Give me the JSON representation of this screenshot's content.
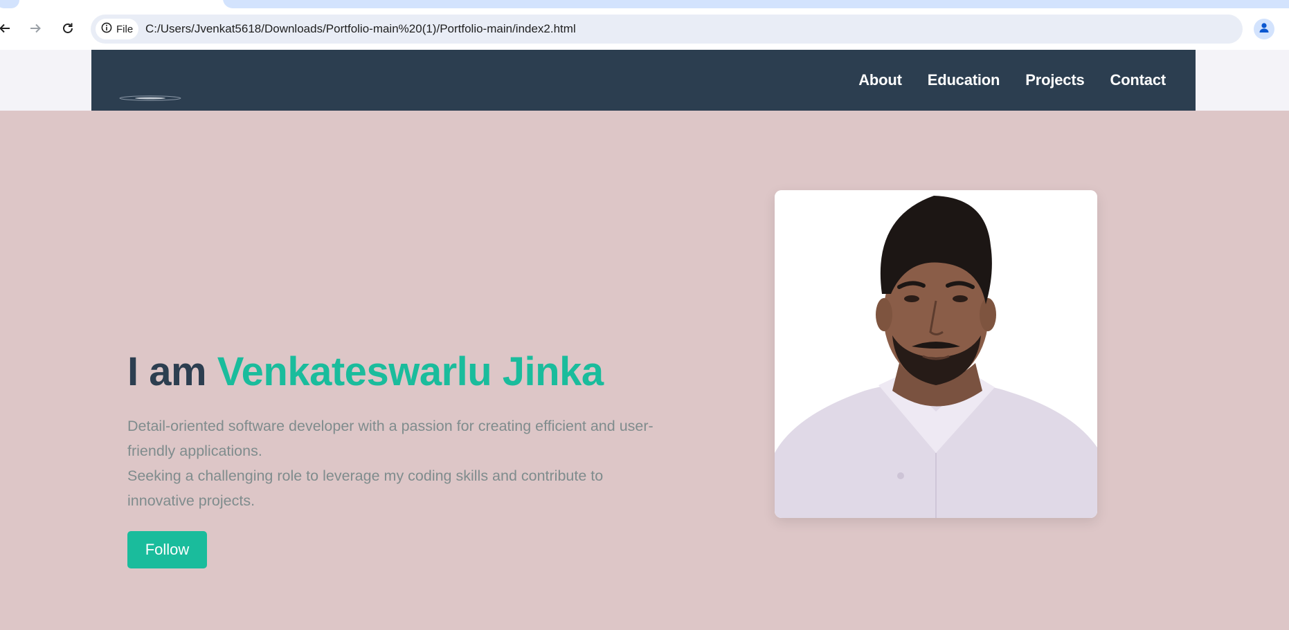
{
  "browser": {
    "file_chip_label": "File",
    "url": "C:/Users/Jvenkat5618/Downloads/Portfolio-main%20(1)/Portfolio-main/index2.html",
    "icons": {
      "back": "back-arrow-icon",
      "forward": "forward-arrow-icon",
      "reload": "reload-icon",
      "info": "info-icon",
      "bookmark": "star-icon",
      "profile": "profile-icon"
    }
  },
  "site": {
    "nav": {
      "items": [
        "About",
        "Education",
        "Projects",
        "Contact"
      ]
    },
    "hero": {
      "title_prefix": "I am",
      "title_name": "Venkateswarlu Jinka",
      "description_line1": "Detail-oriented software developer with a passion for creating efficient and user-friendly applications.",
      "description_line2": "Seeking a challenging role to leverage my coding skills and contribute to innovative projects.",
      "follow_label": "Follow"
    }
  },
  "colors": {
    "header_bg": "#2c3e50",
    "accent": "#1abc9c",
    "page_bg": "#ddc6c7",
    "title_dark": "#2c3e50",
    "body_text": "#7f8c8d"
  }
}
